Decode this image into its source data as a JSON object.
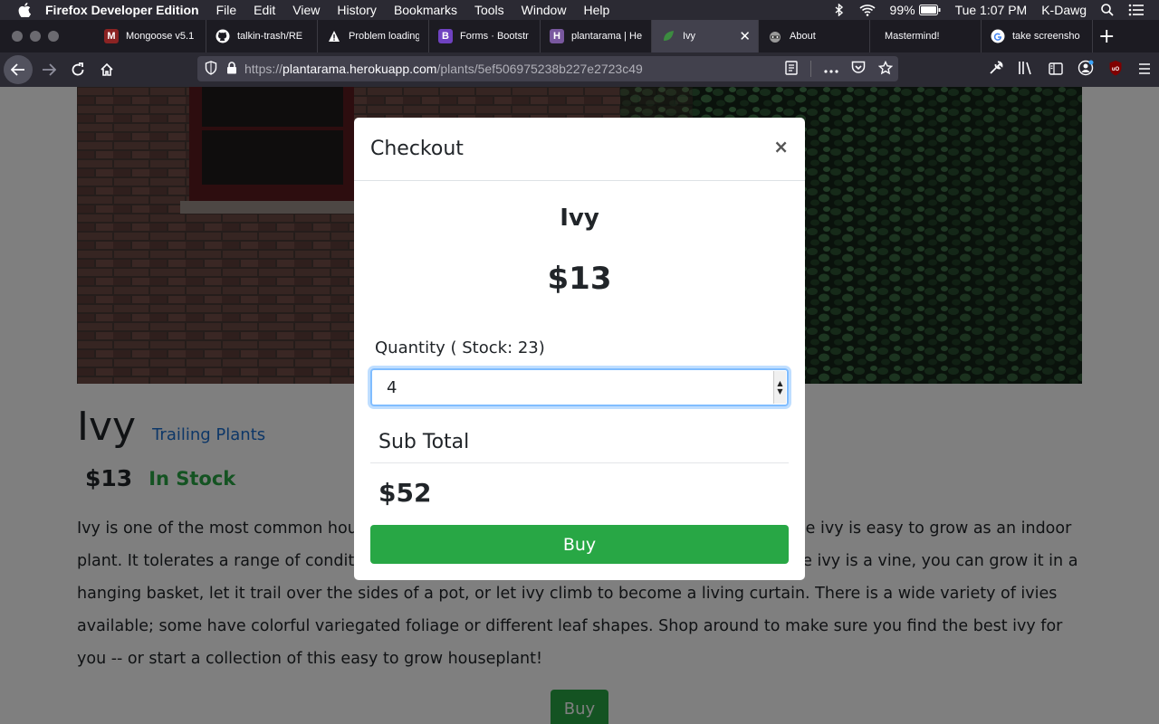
{
  "menubar": {
    "app_name": "Firefox Developer Edition",
    "items": [
      "File",
      "Edit",
      "View",
      "History",
      "Bookmarks",
      "Tools",
      "Window",
      "Help"
    ],
    "battery": "99%",
    "clock": "Tue 1:07 PM",
    "user": "K-Dawg"
  },
  "tabs": [
    {
      "label": "Mongoose v5.1",
      "icon": "mongoose-icon",
      "color": "#8b2323"
    },
    {
      "label": "talkin-trash/RE",
      "icon": "github-icon",
      "color": "#ffffff"
    },
    {
      "label": "Problem loading",
      "icon": "warning-icon",
      "color": "#ffffff"
    },
    {
      "label": "Forms · Bootstr",
      "icon": "bootstrap-icon",
      "color": "#6f42c1"
    },
    {
      "label": "plantarama | He",
      "icon": "heroku-icon",
      "color": "#79589f"
    },
    {
      "label": "Ivy",
      "icon": "leaf-icon",
      "color": "#2e7d32"
    },
    {
      "label": "About",
      "icon": "raccoon-icon",
      "color": "#888888"
    },
    {
      "label": "Mastermind!",
      "icon": "",
      "color": ""
    },
    {
      "label": "take screensho",
      "icon": "google-icon",
      "color": "#4285f4"
    }
  ],
  "url": {
    "prefix": "https://",
    "host": "plantarama.herokuapp.com",
    "path": "/plants/5ef506975238b227e2723c49"
  },
  "page": {
    "name": "Ivy",
    "category": "Trailing Plants",
    "price": "$13",
    "stock_status": "In Stock",
    "description": "Ivy is one of the most common houseplants and has been a favorite for generations because ivy is easy to grow as an indoor plant. It tolerates a range of conditions and doesn't need a lot of light to grow. Plus, because ivy is a vine, you can grow it in a hanging basket, let it trail over the sides of a pot, or let ivy climb to become a living curtain. There is a wide variety of ivies available; some have colorful variegated foliage or different leaf shapes. Shop around to make sure you find the best ivy for you -- or start a collection of this easy to grow houseplant!",
    "buy_label": "Buy"
  },
  "modal": {
    "title": "Checkout",
    "close": "×",
    "plant_name": "Ivy",
    "price": "$13",
    "quantity_label": "Quantity ( Stock: 23)",
    "quantity_value": "4",
    "subtotal_label": "Sub Total",
    "subtotal": "$52",
    "buy_label": "Buy"
  },
  "colors": {
    "accent_green": "#28a745",
    "link_blue": "#1a6fd0",
    "focus_blue": "#80bdff"
  }
}
